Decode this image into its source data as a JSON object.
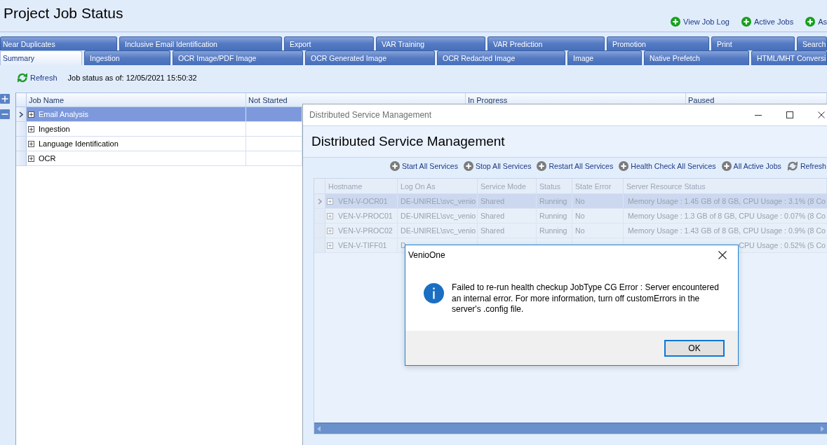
{
  "page_title": "Project Job Status",
  "header_links": [
    {
      "label": "View Job Log"
    },
    {
      "label": "Active Jobs"
    },
    {
      "label": "As"
    }
  ],
  "tab_rows": [
    [
      {
        "label": "Near Duplicates",
        "selected": false
      },
      {
        "label": "Inclusive Email Identification",
        "selected": false
      },
      {
        "label": "Export",
        "selected": false
      },
      {
        "label": "VAR Training",
        "selected": false
      },
      {
        "label": "VAR Prediction",
        "selected": false
      },
      {
        "label": "Promotion",
        "selected": false
      },
      {
        "label": "Print",
        "selected": false
      },
      {
        "label": "Search",
        "selected": false
      }
    ],
    [
      {
        "label": "Summary",
        "selected": true
      },
      {
        "label": "Ingestion",
        "selected": false
      },
      {
        "label": "OCR Image/PDF Image",
        "selected": false
      },
      {
        "label": "OCR Generated Image",
        "selected": false
      },
      {
        "label": "OCR Redacted Image",
        "selected": false
      },
      {
        "label": "Image",
        "selected": false
      },
      {
        "label": "Native Prefetch",
        "selected": false
      },
      {
        "label": "HTML/MHT Conversi",
        "selected": false
      }
    ]
  ],
  "toolbar": {
    "refresh_label": "Refresh",
    "status_text": "Job status as of: 12/05/2021 15:50:32"
  },
  "job_grid": {
    "columns": [
      "Job Name",
      "Not Started",
      "In Progress",
      "Paused"
    ],
    "rows": [
      {
        "job_name": "Email Analysis",
        "selected": true,
        "expanded": false
      },
      {
        "job_name": "Ingestion",
        "selected": false,
        "expanded": false
      },
      {
        "job_name": "Language Identification",
        "selected": false,
        "expanded": false
      },
      {
        "job_name": "OCR",
        "selected": false,
        "expanded": false
      }
    ]
  },
  "service_window": {
    "title": "Distributed Service Management",
    "heading": "Distributed Service Management",
    "actions": [
      {
        "label": "Start All Services",
        "kind": "add"
      },
      {
        "label": "Stop All Services",
        "kind": "add"
      },
      {
        "label": "Restart All Services",
        "kind": "add"
      },
      {
        "label": "Health Check All Services",
        "kind": "add"
      },
      {
        "label": "All Active Jobs",
        "kind": "add"
      },
      {
        "label": "Refresh",
        "kind": "refresh"
      }
    ],
    "grid": {
      "disabled": true,
      "columns": [
        "Hostname",
        "Log On As",
        "Service Mode",
        "Status",
        "State Error",
        "Server Resource Status"
      ],
      "rows": [
        {
          "hostname": "VEN-V-OCR01",
          "log_on_as": "DE-UNIREL\\svc_venio",
          "service_mode": "Shared",
          "status": "Running",
          "state_error": "No",
          "server_resource_status": "Memory Usage : 1.45 GB of 8 GB, CPU Usage : 3.1% (8 Co",
          "selected": true,
          "expanded": false
        },
        {
          "hostname": "VEN-V-PROC01",
          "log_on_as": "DE-UNIREL\\svc_venio",
          "service_mode": "Shared",
          "status": "Running",
          "state_error": "No",
          "server_resource_status": "Memory Usage : 1.3 GB of 8 GB, CPU Usage : 0.07% (8 Co",
          "selected": false,
          "expanded": false
        },
        {
          "hostname": "VEN-V-PROC02",
          "log_on_as": "DE-UNIREL\\svc_venio",
          "service_mode": "Shared",
          "status": "Running",
          "state_error": "No",
          "server_resource_status": "Memory Usage : 1.43 GB of 8 GB, CPU Usage : 0.9% (8 Co",
          "selected": false,
          "expanded": false
        },
        {
          "hostname": "VEN-V-TIFF01",
          "log_on_as": "D",
          "server_resource_status": "CPU Usage : 0.52% (5 Co",
          "selected": false,
          "expanded": false
        }
      ]
    }
  },
  "message_box": {
    "title": "VenioOne",
    "message": "Failed to re-run health checkup JobType CG Error : Server encountered an internal error. For more information, turn off customErrors in the server's .config file.",
    "buttons": [
      "OK"
    ]
  }
}
